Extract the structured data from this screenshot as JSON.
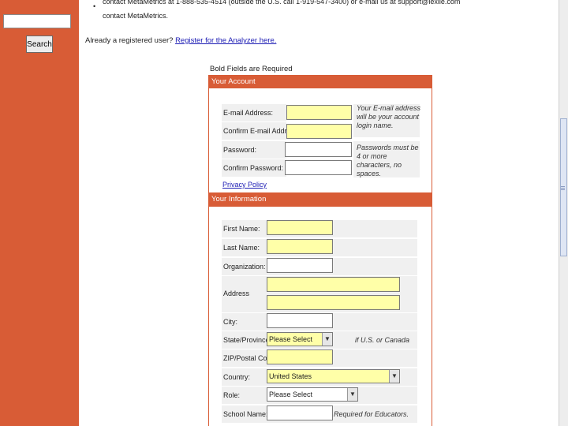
{
  "sidebar": {
    "search_value": "",
    "search_button": "Search"
  },
  "intro": {
    "line1": "contact MetaMetrics at 1-888-535-4514 (outside the U.S. call 1-919-547-3400) or e-mail us at support@lexile.com",
    "line2": "contact MetaMetrics."
  },
  "registered": {
    "text": "Already a registered user?",
    "link": "Register for the Analyzer here."
  },
  "required_note": "Bold Fields are Required",
  "account": {
    "header": "Your Account",
    "email_label": "E-mail Address:",
    "confirm_email_label": "Confirm E-mail Address:",
    "password_label": "Password:",
    "confirm_password_label": "Confirm Password:",
    "email_hint": "Your E-mail address will be your account login name.",
    "password_hint": "Passwords must be 4 or more characters, no spaces.",
    "privacy_link": "Privacy Policy"
  },
  "info": {
    "header": "Your Information",
    "first_name_label": "First Name:",
    "last_name_label": "Last Name:",
    "organization_label": "Organization:",
    "address_label": "Address",
    "city_label": "City:",
    "state_label": "State/Province",
    "state_value": "Please Select",
    "state_hint": "if U.S. or Canada",
    "zip_label": "ZIP/Postal Code:",
    "country_label": "Country:",
    "country_value": "United States",
    "role_label": "Role:",
    "role_value": "Please Select",
    "school_label": "School Name:",
    "school_hint": "Required for Educators."
  },
  "colors": {
    "accent": "#d85c36",
    "required_field": "#ffffa8",
    "link": "#1c1cb4"
  }
}
